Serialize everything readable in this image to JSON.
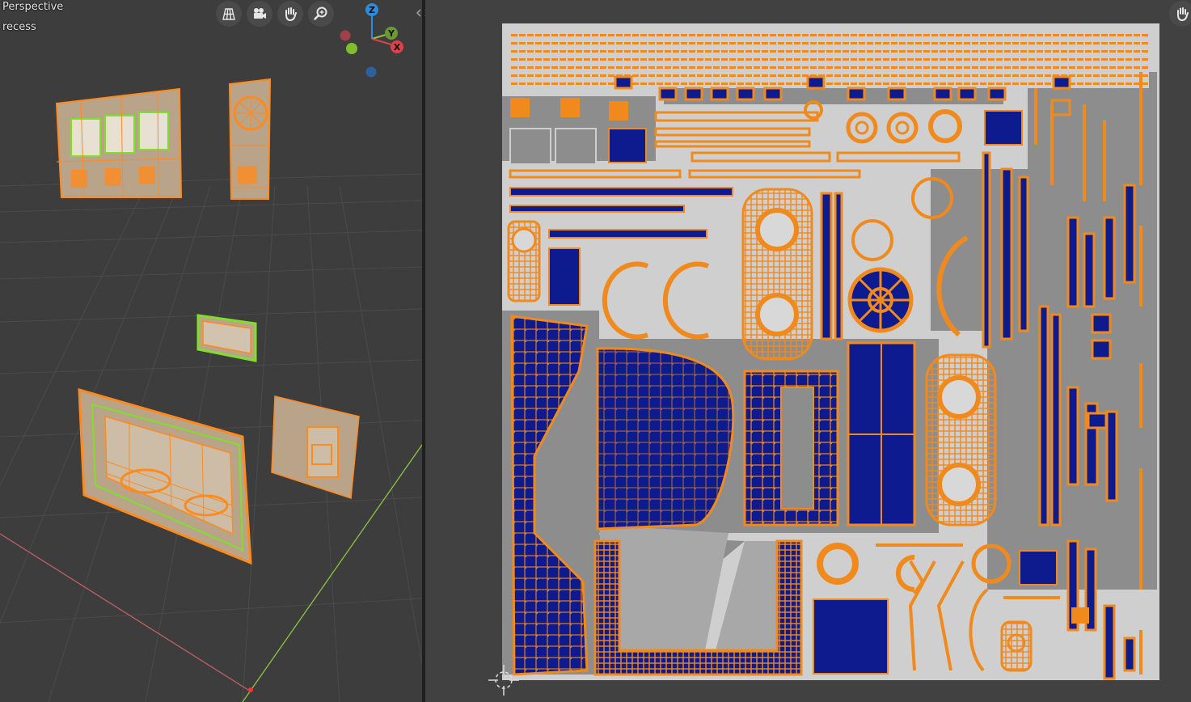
{
  "viewport": {
    "mode_label": "Perspective",
    "object_label": "recess",
    "nav_buttons": [
      {
        "name": "toggle-camera-ortho",
        "icon": "grid-icon"
      },
      {
        "name": "camera-view",
        "icon": "camera-icon"
      },
      {
        "name": "pan-view",
        "icon": "hand-icon"
      },
      {
        "name": "zoom-view",
        "icon": "zoom-icon"
      }
    ],
    "gizmo": {
      "z": "Z",
      "y": "Y",
      "x": "X"
    },
    "colors": {
      "background": "#3d3d3d",
      "grid": "#4a4a4a",
      "x_axis": "#c0606a",
      "y_axis": "#8cc63f",
      "mesh": "#b9a48a",
      "selection": "#ff8a1e",
      "seam": "#7fe02a"
    }
  },
  "uv_editor": {
    "pan_icon": "hand-icon",
    "colors": {
      "background": "#414141",
      "texture_light": "#cfcfcf",
      "texture_mid": "#8d8d8d",
      "texture_dark": "#5e5e5e",
      "island_fill": "#0e1b8f",
      "uv_edge": "#f18a1d"
    }
  }
}
